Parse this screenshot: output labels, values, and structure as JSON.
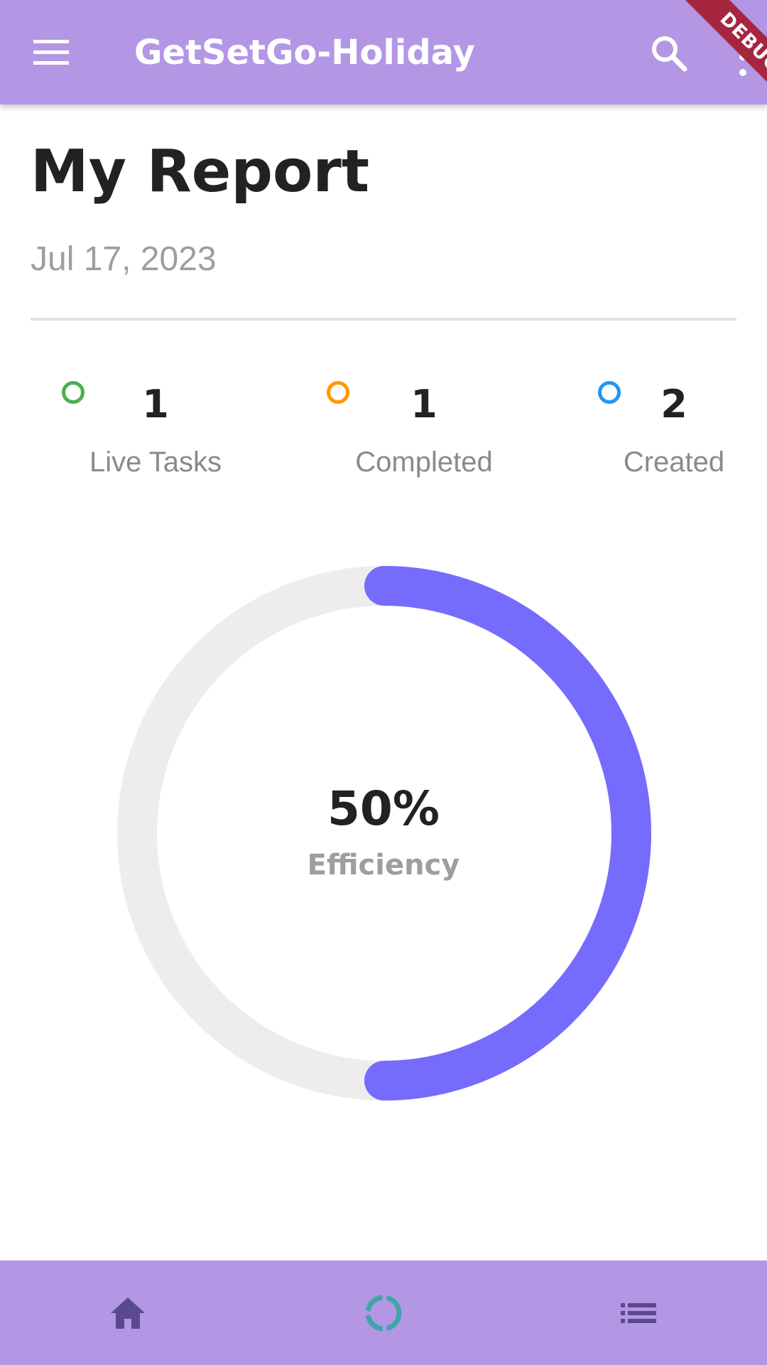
{
  "appbar": {
    "title": "GetSetGo-Holiday",
    "color": "#b397e5",
    "icons": [
      "menu-icon",
      "search-icon",
      "more-vert-icon"
    ],
    "debug_banner": "DEBUG"
  },
  "report": {
    "title": "My Report",
    "date": "Jul 17, 2023"
  },
  "stats": [
    {
      "value": "1",
      "label": "Live Tasks",
      "color": "#4caf50"
    },
    {
      "value": "1",
      "label": "Completed",
      "color": "#ff9800"
    },
    {
      "value": "2",
      "label": "Created",
      "color": "#2196f3"
    }
  ],
  "efficiency": {
    "value_text": "50%",
    "label": "Efficiency",
    "fraction": 0.5,
    "progress_color": "#756bfc",
    "track_color": "#ededed"
  },
  "bottom_nav": {
    "items": [
      {
        "icon": "home-icon",
        "selected": false
      },
      {
        "icon": "ring-progress-icon",
        "selected": true
      },
      {
        "icon": "list-icon",
        "selected": false
      }
    ]
  }
}
